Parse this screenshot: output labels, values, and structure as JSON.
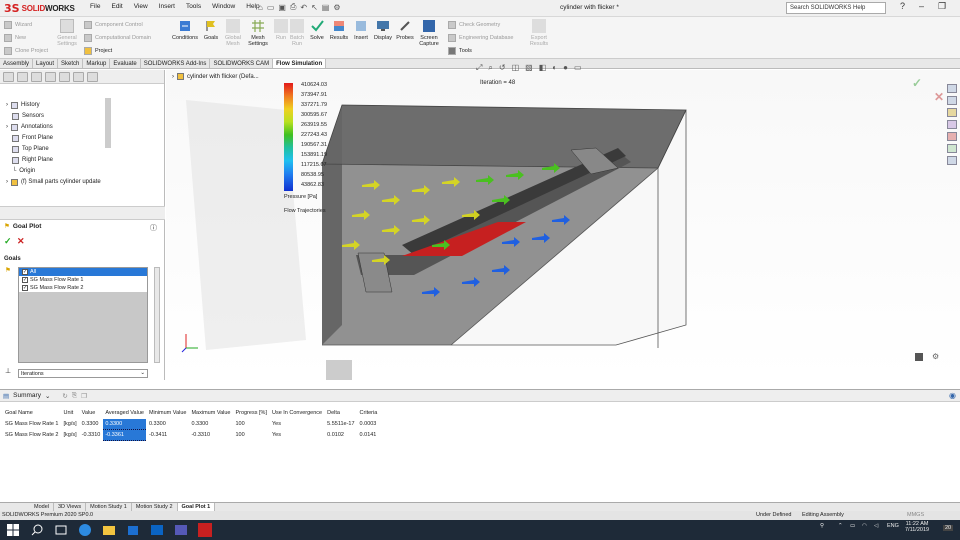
{
  "app": {
    "logo_mark": "3S",
    "logo_name": "SOLID",
    "logo_name_bold": "WORKS"
  },
  "menu": [
    "File",
    "Edit",
    "View",
    "Insert",
    "Tools",
    "Window",
    "Help"
  ],
  "doc_title": "cylinder with flicker *",
  "search_placeholder": "Search SOLIDWORKS Help",
  "ribbon": {
    "left_col1": [
      "Wizard",
      "New",
      "Clone Project"
    ],
    "left_col2": [
      "General Settings"
    ],
    "project_col": [
      "Component Control",
      "Computational Domain",
      "Project"
    ],
    "buttons": [
      "Conditions",
      "Goals",
      "Global Mesh",
      "Mesh Settings",
      "Run",
      "Batch Run",
      "Solve",
      "Results",
      "Insert",
      "Display",
      "Probes",
      "Screen Capture"
    ],
    "right_col": [
      "Check Geometry",
      "Engineering Database",
      "Tools"
    ],
    "export": "Export Results"
  },
  "tabs": [
    "Assembly",
    "Layout",
    "Sketch",
    "Markup",
    "Evaluate",
    "SOLIDWORKS Add-Ins",
    "SOLIDWORKS CAM",
    "Flow Simulation"
  ],
  "tree": {
    "root": "cylinder with flicker  (Defa...",
    "items": [
      "History",
      "Sensors",
      "Annotations",
      "Front Plane",
      "Top Plane",
      "Right Plane",
      "Origin",
      "(f) Small parts cylinder update"
    ]
  },
  "goal_plot": {
    "title": "Goal Plot",
    "goals_label": "Goals",
    "goals": [
      "All",
      "SG Mass Flow Rate 1",
      "SG Mass Flow Rate 2"
    ],
    "x_axis_select": "Iterations"
  },
  "viewport": {
    "iteration": "Iteration = 48",
    "legend_values": [
      "410624.03",
      "373947.91",
      "337271.79",
      "300595.67",
      "263919.55",
      "227243.43",
      "190567.31",
      "153891.19",
      "117215.07",
      "80538.95",
      "43862.83"
    ],
    "legend_title": "Pressure [Pa]",
    "trajectories": "Flow Trajectories"
  },
  "summary": {
    "title": "Summary",
    "columns": [
      "Goal Name",
      "Unit",
      "Value",
      "Averaged Value",
      "Minimum Value",
      "Maximum Value",
      "Progress [%]",
      "Use In Convergence",
      "Delta",
      "Criteria"
    ],
    "rows": [
      [
        "SG Mass Flow Rate 1",
        "[kg/s]",
        "0.3300",
        "0.3300",
        "0.3300",
        "0.3300",
        "100",
        "Yes",
        "5.5511e-17",
        "0.0003"
      ],
      [
        "SG Mass Flow Rate 2",
        "[kg/s]",
        "-0.3310",
        "-0.3361",
        "-0.3411",
        "-0.3310",
        "100",
        "Yes",
        "0.0102",
        "0.0141"
      ]
    ]
  },
  "bottom_tabs": [
    "Model",
    "3D Views",
    "Motion Study 1",
    "Motion Study 2",
    "Goal Plot 1"
  ],
  "status": {
    "left": "SOLIDWORKS Premium 2020 SP0.0",
    "defined": "Under Defined",
    "mode": "Editing Assembly",
    "units": "MMGS"
  },
  "taskbar": {
    "time": "11:22 AM",
    "date": "7/11/2019",
    "lang": "ENG",
    "notify": "20"
  },
  "colors": {
    "accent": "#2878d7",
    "brand": "#d42020",
    "taskbar": "#1e2a38"
  }
}
